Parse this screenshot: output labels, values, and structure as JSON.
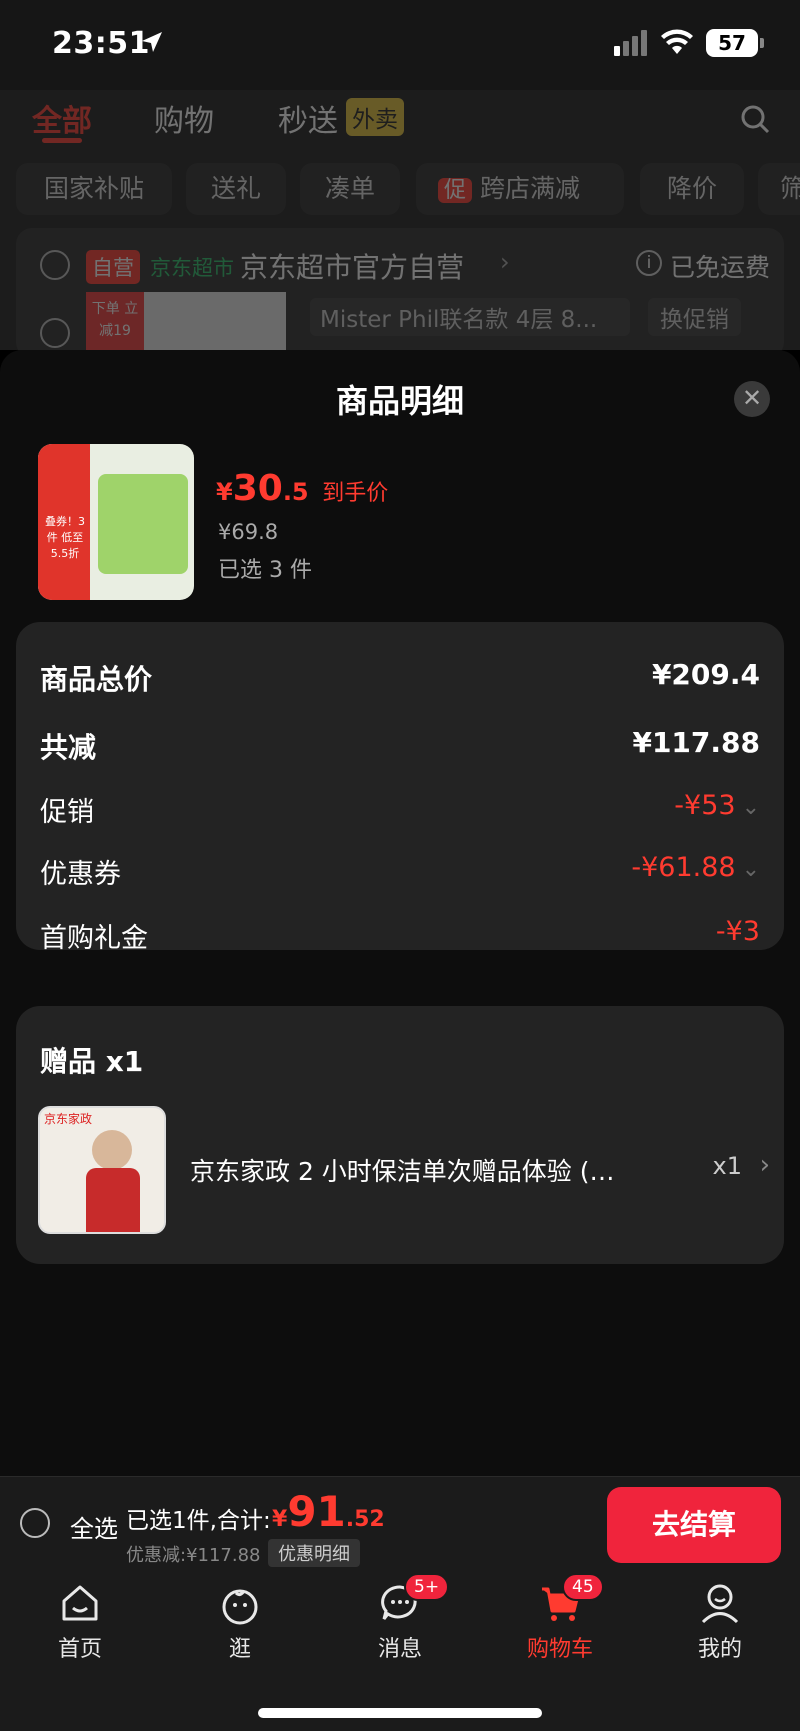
{
  "status_bar": {
    "time": "23:51",
    "battery": "57"
  },
  "background": {
    "tabs": [
      "全部",
      "购物",
      "秒送"
    ],
    "tab_badge": "外卖",
    "filters": [
      "国家补贴",
      "送礼",
      "凑单",
      "跨店满减",
      "降价",
      "筛"
    ],
    "filter_promo_badge": "促",
    "store": {
      "self_badge": "自营",
      "supermarket_tag": "京东超市",
      "name": "京东超市官方自营",
      "shipping": "已免运费"
    },
    "item_variant": "Mister Phil联名款 4层 8...",
    "item_promo_button": "换促销",
    "item_thumb_text": "下单 立减19"
  },
  "sheet": {
    "title": "商品明细",
    "product": {
      "currency": "¥",
      "price_int": "30",
      "price_dec": ".5",
      "price_label": "到手价",
      "original_price": "¥69.8",
      "selected": "已选 3 件",
      "thumb_text": "叠券！3件 低至5.5折"
    },
    "summary": [
      {
        "label": "商品总价",
        "value": "¥209.4",
        "bold": true
      },
      {
        "label": "共减",
        "value": "¥117.88",
        "bold": true
      },
      {
        "label": "促销",
        "value": "-¥53",
        "red": true,
        "chevron": true
      },
      {
        "label": "优惠券",
        "value": "-¥61.88",
        "red": true,
        "chevron": true
      },
      {
        "label": "首购礼金",
        "value": "-¥3",
        "red": true
      }
    ],
    "gifts": {
      "title": "赠品 x1",
      "item_name": "京东家政 2 小时保洁单次赠品体验 (…",
      "qty": "x1",
      "thumb_brand": "京东家政"
    }
  },
  "checkout": {
    "select_all": "全选",
    "selected_text": "已选1件,合计:",
    "total_currency": "¥",
    "total_int": "91",
    "total_dec": ".52",
    "discount_text": "优惠减:¥117.88",
    "discount_detail": "优惠明细",
    "checkout_button": "去结算"
  },
  "tabbar": {
    "items": [
      {
        "label": "首页"
      },
      {
        "label": "逛"
      },
      {
        "label": "消息",
        "badge": "5+"
      },
      {
        "label": "购物车",
        "badge": "45",
        "active": true
      },
      {
        "label": "我的"
      }
    ]
  },
  "colors": {
    "accent": "#ff3b30",
    "button": "#f0243c"
  }
}
